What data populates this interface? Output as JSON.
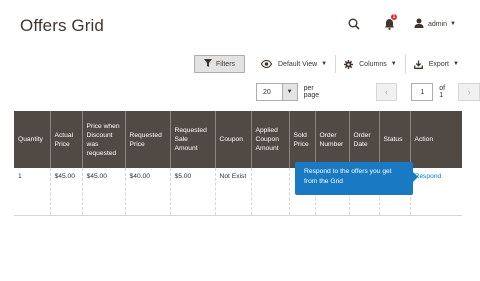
{
  "header": {
    "title": "Offers Grid",
    "notification_count": "1",
    "user_name": "admin"
  },
  "toolbar": {
    "filters_label": "Filters",
    "view_label": "Default View",
    "columns_label": "Columns",
    "export_label": "Export"
  },
  "pager": {
    "per_page_value": "20",
    "per_page_label": "per page",
    "current_page": "1",
    "of_label": "of 1"
  },
  "grid": {
    "columns": [
      "Quantity",
      "Actual Price",
      "Price when Discount was requested",
      "Requested Price",
      "Requested Sale Amount",
      "Coupon",
      "Applied Coupon Amount",
      "Sold Price",
      "Order Number",
      "Order Date",
      "Status",
      "Action"
    ],
    "rows": [
      {
        "quantity": "1",
        "actual_price": "$45.00",
        "price_when_discount": "$45.00",
        "requested_price": "$40.00",
        "requested_sale_amount": "$5.00",
        "coupon": "Not Exist",
        "applied_coupon_amount": "",
        "sold_price": "",
        "order_number": "",
        "order_date": "",
        "status": "",
        "action": "Respond"
      }
    ]
  },
  "tooltip": {
    "text": "Respond to the offers you get from the Grid"
  },
  "colors": {
    "header_bg": "#514943",
    "link": "#007bdb",
    "tooltip_bg": "#1979c3",
    "badge": "#e22626"
  }
}
